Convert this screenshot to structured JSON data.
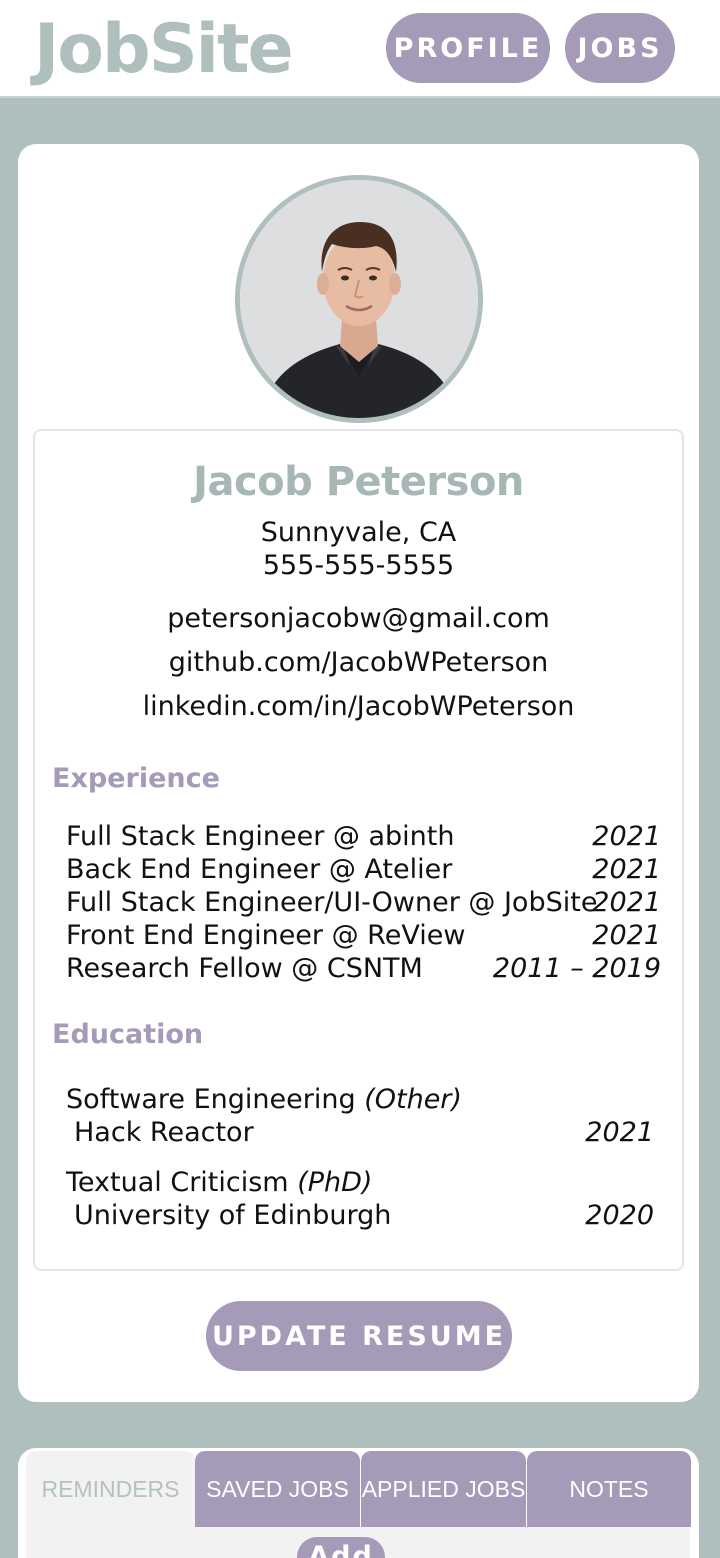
{
  "header": {
    "logo": "JobSite",
    "nav": {
      "profile": "PROFILE",
      "jobs": "JOBS"
    }
  },
  "profile": {
    "name": "Jacob Peterson",
    "location": "Sunnyvale, CA",
    "phone": "555-555-5555",
    "email": "petersonjacobw@gmail.com",
    "github": "github.com/JacobWPeterson",
    "linkedin": "linkedin.com/in/JacobWPeterson"
  },
  "experience": {
    "title": "Experience",
    "items": [
      {
        "role": "Full Stack Engineer @ abinth",
        "years": "2021"
      },
      {
        "role": "Back End Engineer @ Atelier",
        "years": "2021"
      },
      {
        "role": "Full Stack Engineer/UI-Owner @ JobSite",
        "years": "2021"
      },
      {
        "role": "Front End Engineer @ ReView",
        "years": "2021"
      },
      {
        "role": "Research Fellow @ CSNTM",
        "years": "2011 – 2019"
      }
    ]
  },
  "education": {
    "title": "Education",
    "items": [
      {
        "field": "Software Engineering",
        "degree": "(Other)",
        "school": "Hack Reactor",
        "year": "2021"
      },
      {
        "field": "Textual Criticism",
        "degree": "(PhD)",
        "school": "University of Edinburgh",
        "year": "2020"
      }
    ]
  },
  "update_button": "UPDATE RESUME",
  "tabs": [
    "REMINDERS",
    "SAVED JOBS",
    "APPLIED JOBS",
    "NOTES"
  ],
  "active_tab": "REMINDERS",
  "add_button": "Add",
  "colors": {
    "accent": "#a59ab7",
    "sage": "#afbfbe",
    "background": "#afbfbe"
  }
}
